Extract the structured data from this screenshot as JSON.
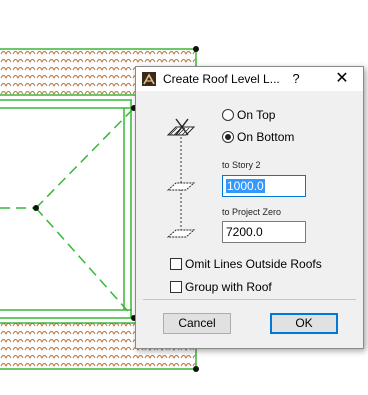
{
  "dialog": {
    "title": "Create Roof Level L...",
    "help": "?",
    "close": "✕",
    "options": [
      {
        "label": "On Top",
        "checked": false
      },
      {
        "label": "On Bottom",
        "checked": true
      }
    ],
    "story_label": "to Story 2",
    "story_value": "1000.0",
    "zero_label": "to Project Zero",
    "zero_value": "7200.0",
    "checkboxes": [
      {
        "label": "Omit Lines Outside Roofs",
        "checked": false
      },
      {
        "label": "Group with Roof",
        "checked": false
      }
    ],
    "cancel": "Cancel",
    "ok": "OK"
  },
  "colors": {
    "roof_line": "#38b838",
    "roof_hatch": "#b5703a",
    "accent": "#0078d7"
  }
}
